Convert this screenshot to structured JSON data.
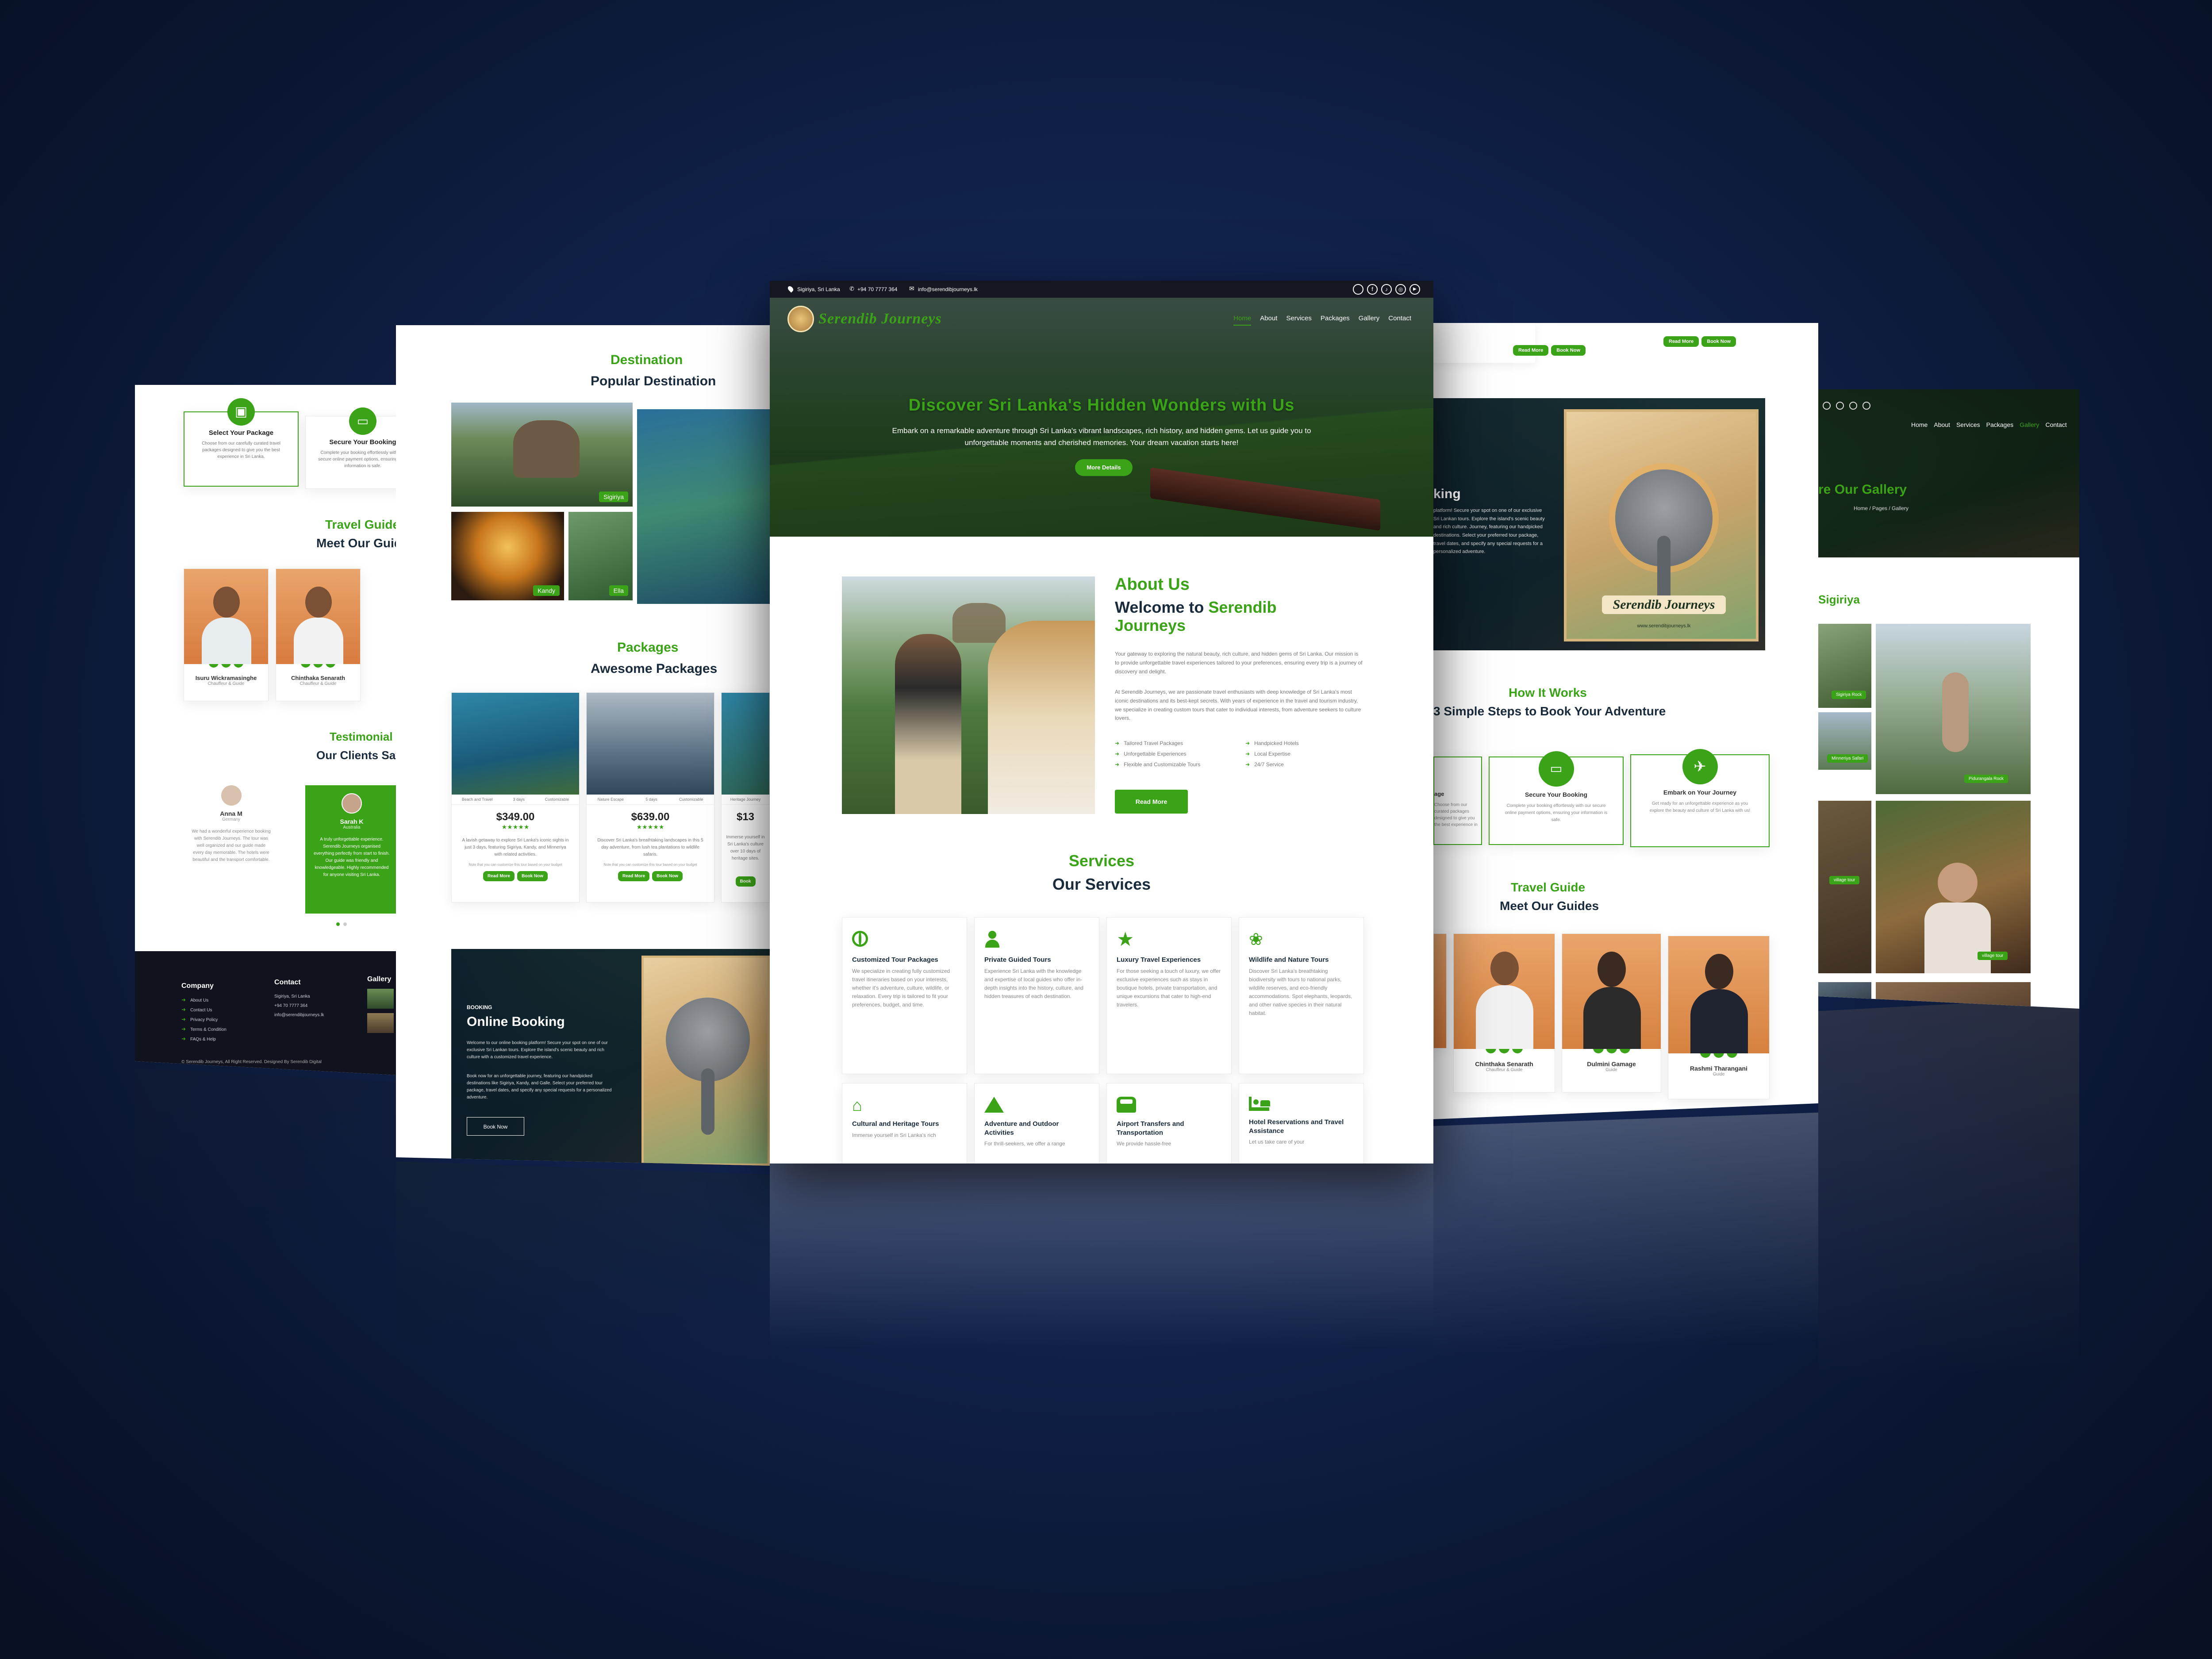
{
  "topbar": {
    "location": "Sigiriya, Sri Lanka",
    "phone": "+94 70 7777 364",
    "email": "info@serendibjourneys.lk"
  },
  "brand": {
    "name": "Serendib Journeys"
  },
  "nav": [
    "Home",
    "About",
    "Services",
    "Packages",
    "Gallery",
    "Contact"
  ],
  "hero": {
    "title": "Discover Sri Lanka's Hidden Wonders with Us",
    "text": "Embark on a remarkable adventure through Sri Lanka's vibrant landscapes, rich history, and hidden gems. Let us guide you to unforgettable moments and cherished memories. Your dream vacation starts here!",
    "button": "More Details"
  },
  "about": {
    "kicker": "About Us",
    "heading_prefix": "Welcome to ",
    "heading_brand": "Serendib Journeys",
    "p1": "Your gateway to exploring the natural beauty, rich culture, and hidden gems of Sri Lanka. Our mission is to provide unforgettable travel experiences tailored to your preferences, ensuring every trip is a journey of discovery and delight.",
    "p2": "At Serendib Journeys, we are passionate travel enthusiasts with deep knowledge of Sri Lanka's most iconic destinations and its best-kept secrets. With years of experience in the travel and tourism industry, we specialize in creating custom tours that cater to individual interests, from adventure seekers to culture lovers.",
    "features": [
      "Tailored Travel Packages",
      "Handpicked Hotels",
      "Unforgettable Experiences",
      "Local Expertise",
      "Flexible and Customizable Tours",
      "24/7 Service"
    ],
    "button": "Read More"
  },
  "services": {
    "kicker": "Services",
    "heading": "Our Services",
    "items": [
      {
        "icon": "globe-icon",
        "title": "Customized Tour Packages",
        "text": "We specialize in creating fully customized travel itineraries based on your interests, whether it's adventure, culture, wildlife, or relaxation. Every trip is tailored to fit your preferences, budget, and time."
      },
      {
        "icon": "person-icon",
        "title": "Private Guided Tours",
        "text": "Experience Sri Lanka with the knowledge and expertise of local guides who offer in-depth insights into the history, culture, and hidden treasures of each destination."
      },
      {
        "icon": "star-icon",
        "title": "Luxury Travel Experiences",
        "text": "For those seeking a touch of luxury, we offer exclusive experiences such as stays in boutique hotels, private transportation, and unique excursions that cater to high-end travelers."
      },
      {
        "icon": "paw-icon",
        "title": "Wildlife and Nature Tours",
        "text": "Discover Sri Lanka's breathtaking biodiversity with tours to national parks, wildlife reserves, and eco-friendly accommodations. Spot elephants, leopards, and other native species in their natural habitat."
      },
      {
        "icon": "temple-icon",
        "title": "Cultural and Heritage Tours",
        "text": "Immerse yourself in Sri Lanka's rich"
      },
      {
        "icon": "mountain-icon",
        "title": "Adventure and Outdoor Activities",
        "text": "For thrill-seekers, we offer a range"
      },
      {
        "icon": "car-icon",
        "title": "Airport Transfers and Transportation",
        "text": "We provide hassle-free"
      },
      {
        "icon": "bed-icon",
        "title": "Hotel Reservations and Travel Assistance",
        "text": "Let us take care of your"
      }
    ]
  },
  "left_panel": {
    "steps": [
      {
        "title": "Select Your Package",
        "text": "Choose from our carefully curated travel packages designed to give you the best experience in Sri Lanka."
      },
      {
        "title": "Secure Your Booking",
        "text": "Complete your booking effortlessly with our secure online payment options, ensuring your information is safe."
      }
    ],
    "guides_kicker": "Travel Guide",
    "guides_heading": "Meet Our Guide",
    "guides": [
      {
        "name": "Isuru Wickramasinghe",
        "role": "Chauffeur & Guide"
      },
      {
        "name": "Chinthaka Senarath",
        "role": "Chauffeur & Guide"
      }
    ],
    "testimonial_kicker": "Testimonial",
    "testimonial_heading": "Our Clients Say",
    "testimonials": [
      {
        "name": "Anna M",
        "place": "Germany",
        "text": "We had a wonderful experience booking with Serendib Journeys. The tour was well organized and our guide made every day memorable. The hotels were beautiful and the transport comfortable."
      },
      {
        "name": "Sarah K",
        "place": "Australia",
        "text": "A truly unforgettable experience. Serendib Journeys organised everything perfectly from start to finish. Our guide was friendly and knowledgeable. Highly recommended for anyone visiting Sri Lanka."
      }
    ],
    "footer": {
      "company": "Company",
      "links": [
        "About Us",
        "Contact Us",
        "Privacy Policy",
        "Terms & Condition",
        "FAQs & Help"
      ],
      "contact": "Contact",
      "contact_items": [
        "Sigiriya, Sri Lanka",
        "+94 70 7777 364",
        "info@serendibjourneys.lk"
      ],
      "gallery": "Gallery",
      "copyright": "© Serendib Journeys, All Right Reserved. Designed By Serendib Digital"
    }
  },
  "second_panel": {
    "dest_kicker": "Destination",
    "dest_heading": "Popular Destination",
    "dest_tags": [
      "Sigiriya",
      "Kandy",
      "Ella"
    ],
    "packages_kicker": "Packages",
    "packages_heading": "Awesome Packages",
    "packages": [
      {
        "tags": [
          "Beach and Travel",
          "3 days",
          "Customizable"
        ],
        "price": "$349.00",
        "text": "A lavish getaway to explore Sri Lanka's iconic sights in just 3 days, featuring Sigiriya, Kandy, and Minneriya with related activities.",
        "note": "Note that you can customize this tour based on your budget",
        "btn1": "Read More",
        "btn2": "Book Now"
      },
      {
        "tags": [
          "Nature Escape",
          "5 days",
          "Customizable"
        ],
        "price": "$639.00",
        "text": "Discover Sri Lanka's breathtaking landscapes in this 5 day adventure, from lush tea plantations to wildlife safaris.",
        "note": "Note that you can customize this tour based on your budget",
        "btn1": "Read More",
        "btn2": "Book Now"
      },
      {
        "tags": [
          "Heritage Journey"
        ],
        "price": "$13",
        "text": "Immerse yourself in Sri Lanka's culture over 10 days of heritage sites.",
        "note": "",
        "btn1": "",
        "btn2": "Book"
      }
    ],
    "booking_kicker": "BOOKING",
    "booking_heading": "Online Booking",
    "booking_text1": "Welcome to our online booking platform! Secure your spot on one of our exclusive Sri Lankan tours. Explore the island's scenic beauty and rich culture with a customized travel experience.",
    "booking_text2": "Book now for an unforgettable journey, featuring our handpicked destinations like Sigiriya, Kandy, and Galle. Select your preferred tour package, travel dates, and specify any special requests for a personalized adventure.",
    "booking_btn": "Book Now"
  },
  "fourth_panel": {
    "top_btn1": "Read More",
    "top_btn2": "Book Now",
    "booking_word": "king",
    "booking_text": "platform! Secure your spot on one of our exclusive Sri Lankan tours. Explore the island's scenic beauty and rich culture. Journey, featuring our handpicked destinations. Select your preferred tour package, travel dates, and specify any special requests for a personalized adventure.",
    "logo_text": "Serendib Journeys",
    "logo_url": "www.serendibjourneys.lk",
    "how_kicker": "How It Works",
    "how_heading": "3 Simple Steps to Book Your Adventure",
    "steps": [
      {
        "title": "Select Your Package",
        "short": "age",
        "text": "Choose from our curated packages designed to give you the best experience in Sri."
      },
      {
        "title": "Secure Your Booking",
        "text": "Complete your booking effortlessly with our secure online payment options, ensuring your information is safe."
      },
      {
        "title": "Embark on Your Journey",
        "text": "Get ready for an unforgettable experience as you explore the beauty and culture of Sri Lanka with us!"
      }
    ],
    "guides_kicker": "Travel Guide",
    "guides_heading": "Meet Our Guides",
    "guides": [
      {
        "name": "Chinthaka Senarath",
        "role": "Chauffeur & Guide"
      },
      {
        "name": "Dulmini Gamage",
        "role": "Guide"
      },
      {
        "name": "Rashmi Tharangani",
        "role": "Guide"
      }
    ]
  },
  "fifth_panel": {
    "nav": [
      "Home",
      "About",
      "Services",
      "Packages",
      "Gallery",
      "Contact"
    ],
    "title": "Explore Our Gallery",
    "title_visible": "re Our Gallery",
    "breadcrumb": "Home / Pages / Gallery",
    "section": "Sigiriya",
    "tags": [
      "Sigiriya Rock",
      "Pidurangala Rock",
      "village tour",
      "village tour",
      "village tour",
      "village tour",
      "Minneriya Safari"
    ]
  },
  "colors": {
    "accent": "#3aa317",
    "dark": "#10131e",
    "background": "#0f1f47"
  }
}
